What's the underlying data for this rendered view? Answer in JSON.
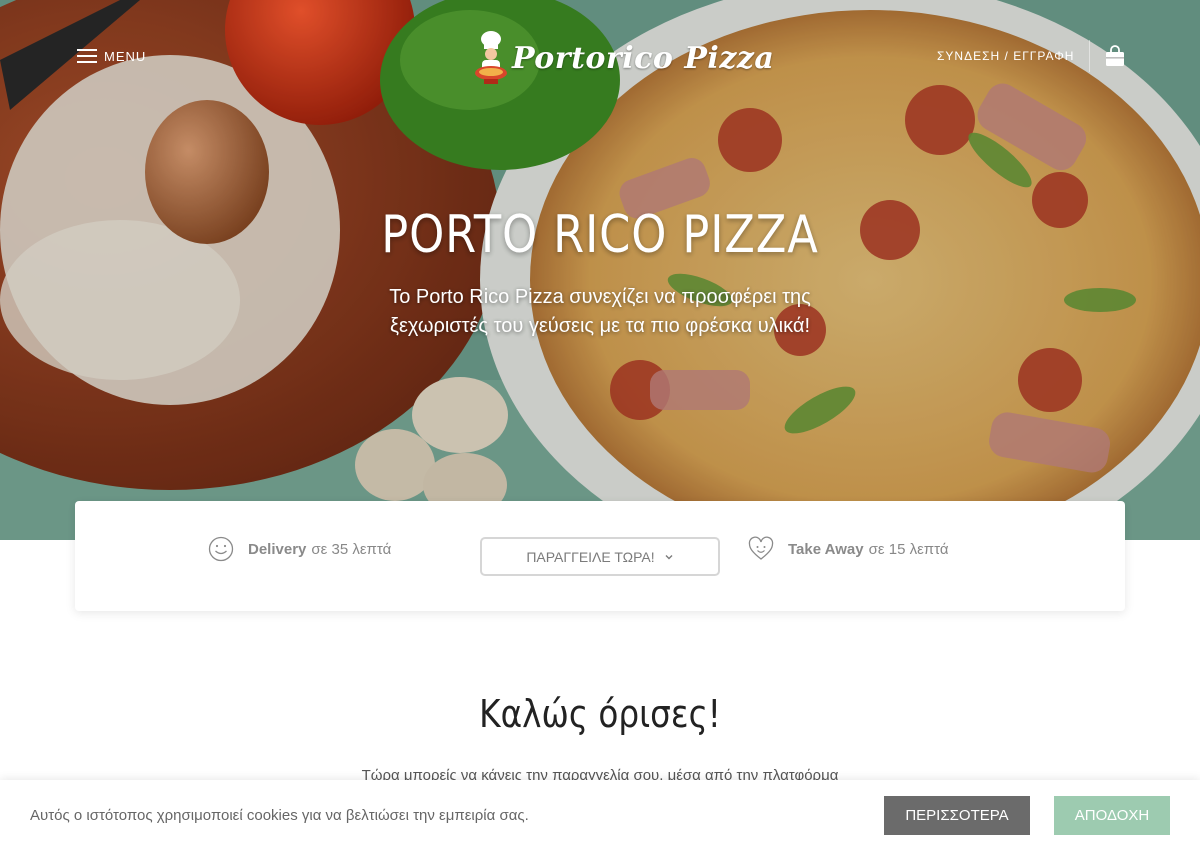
{
  "header": {
    "menu_label": "MENU",
    "logo_text": "Portorico Pizza",
    "login_label": "ΣΥΝΔΕΣΗ / ΕΓΓΡΑΦΗ"
  },
  "hero": {
    "title": "PORTO RICO PIZZA",
    "subtitle": "Το Porto Rico Pizza συνεχίζει να προσφέρει της ξεχωριστές του γεύσεις με τα πιο φρέσκα υλικά!"
  },
  "order_card": {
    "delivery": {
      "label": "Delivery",
      "time": "σε 35 λεπτά",
      "icon": "smiley-icon"
    },
    "order_button": "ΠΑΡΑΓΓΕΙΛΕ ΤΩΡΑ!",
    "takeaway": {
      "label": "Take Away",
      "time": "σε 15 λεπτά",
      "icon": "heart-face-icon"
    }
  },
  "welcome": {
    "title": "Καλώς όρισες!",
    "text": "Τώρα μπορείς να κάνεις την παραγγελία σου, μέσα από την πλατφόρμα"
  },
  "cookie_bar": {
    "text": "Αυτός ο ιστότοπος χρησιμοποιεί cookies για να βελτιώσει την εμπειρία σας.",
    "more_label": "ΠΕΡΙΣΣΟΤΕΡΑ",
    "accept_label": "ΑΠΟΔΟΧΗ"
  },
  "colors": {
    "accept_button": "#9dcbb0",
    "more_button": "#6b6b6b",
    "hero_background": "#6fa190"
  }
}
